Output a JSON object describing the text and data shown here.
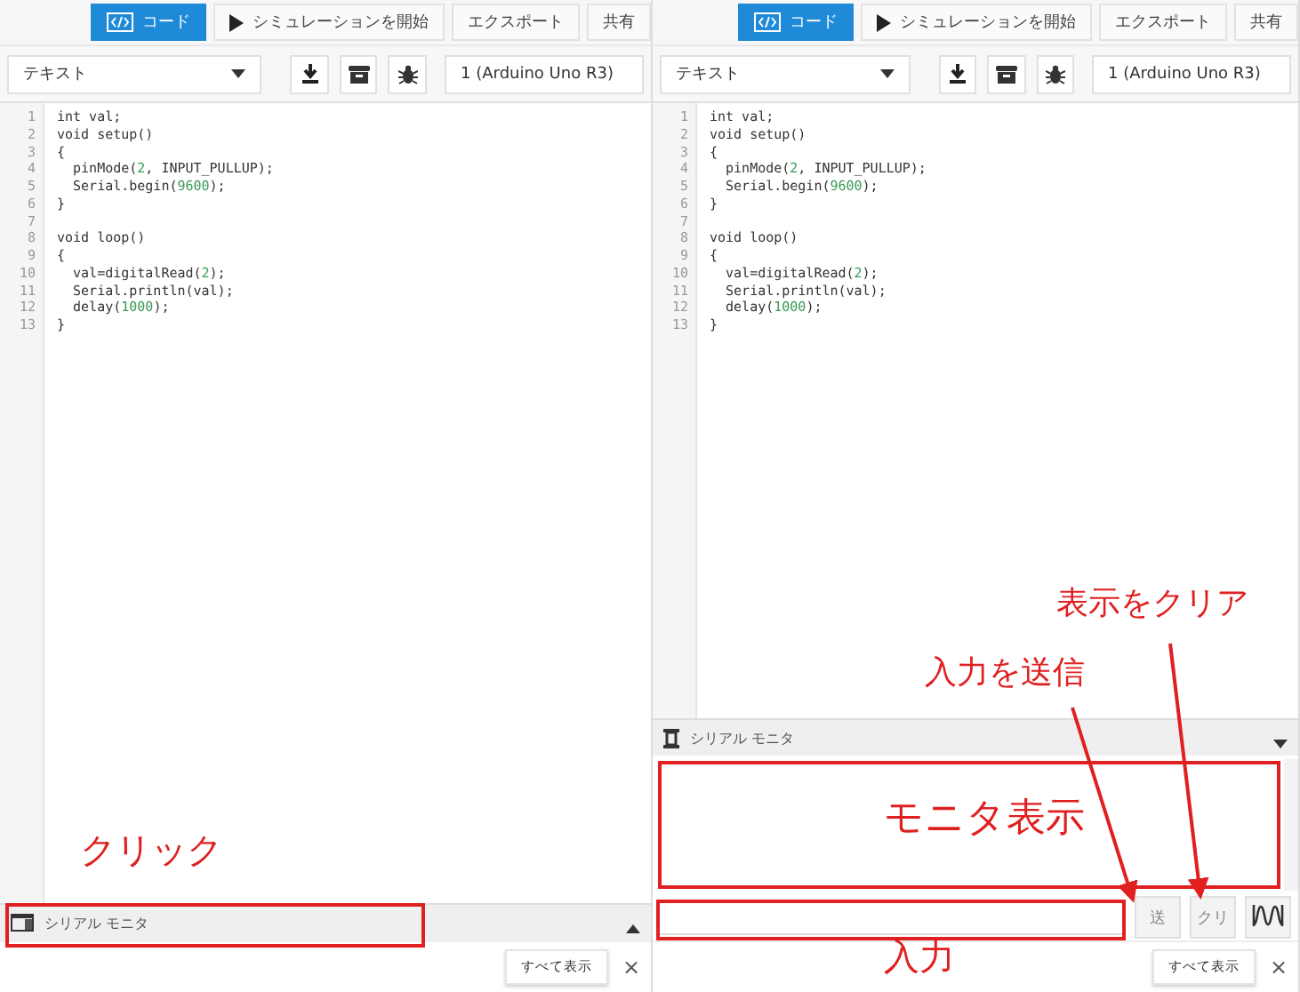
{
  "panels": [
    {
      "toolbar": [
        {
          "kind": "code",
          "label": "コード",
          "selected": true
        },
        {
          "kind": "play",
          "label": "シミュレーションを開始",
          "selected": false
        },
        {
          "kind": "plain",
          "label": "エクスポート",
          "selected": false
        },
        {
          "kind": "plain",
          "label": "共有",
          "selected": false
        }
      ],
      "editor_mode": "テキスト",
      "board": "1 (Arduino Uno R3)",
      "code_lines": [
        {
          "number": "1",
          "text": "int val;"
        },
        {
          "number": "2",
          "text": "void setup()"
        },
        {
          "number": "3",
          "text": "{"
        },
        {
          "number": "4",
          "text": "  pinMode(2, INPUT_PULLUP);"
        },
        {
          "number": "5",
          "text": "  Serial.begin(9600);"
        },
        {
          "number": "6",
          "text": "}"
        },
        {
          "number": "7"
        },
        {
          "number": "8",
          "text": "void loop()"
        },
        {
          "number": "9",
          "text": "{"
        },
        {
          "number": "10",
          "text": "  val=digitalRead(2);"
        },
        {
          "number": "11",
          "text": "  Serial.println(val);"
        },
        {
          "number": "12",
          "text": "  delay(1000);"
        },
        {
          "number": "13",
          "text": "}"
        }
      ],
      "serial_monitor": {
        "title": "シリアル モニタ",
        "expanded": false
      },
      "footer_button": "すべて表示",
      "footer_close": "×"
    },
    {
      "toolbar": [
        {
          "kind": "code",
          "label": "コード",
          "selected": true
        },
        {
          "kind": "play",
          "label": "シミュレーションを開始",
          "selected": false
        },
        {
          "kind": "plain",
          "label": "エクスポート",
          "selected": false
        },
        {
          "kind": "plain",
          "label": "共有",
          "selected": false
        }
      ],
      "editor_mode": "テキスト",
      "board": "1 (Arduino Uno R3)",
      "code_lines": [
        {
          "number": "1",
          "text": "int val;"
        },
        {
          "number": "2",
          "text": "void setup()"
        },
        {
          "number": "3",
          "text": "{"
        },
        {
          "number": "4",
          "text": "  pinMode(2, INPUT_PULLUP);"
        },
        {
          "number": "5",
          "text": "  Serial.begin(9600);"
        },
        {
          "number": "6",
          "text": "}"
        },
        {
          "number": "7"
        },
        {
          "number": "8",
          "text": "void loop()"
        },
        {
          "number": "9",
          "text": "{"
        },
        {
          "number": "10",
          "text": "  val=digitalRead(2);"
        },
        {
          "number": "11",
          "text": "  Serial.println(val);"
        },
        {
          "number": "12",
          "text": "  delay(1000);"
        },
        {
          "number": "13",
          "text": "}"
        }
      ],
      "serial_monitor": {
        "title": "シリアル モニタ",
        "expanded": true,
        "send_button": "送",
        "clear_button": "クリ"
      },
      "footer_button": "すべて表示",
      "footer_close": "×"
    }
  ],
  "annotations": [
    {
      "text": "クリック"
    },
    {
      "text": "モニタ表示"
    },
    {
      "text": "入力"
    },
    {
      "text": "入力を送信"
    },
    {
      "text": "表示をクリア"
    }
  ]
}
